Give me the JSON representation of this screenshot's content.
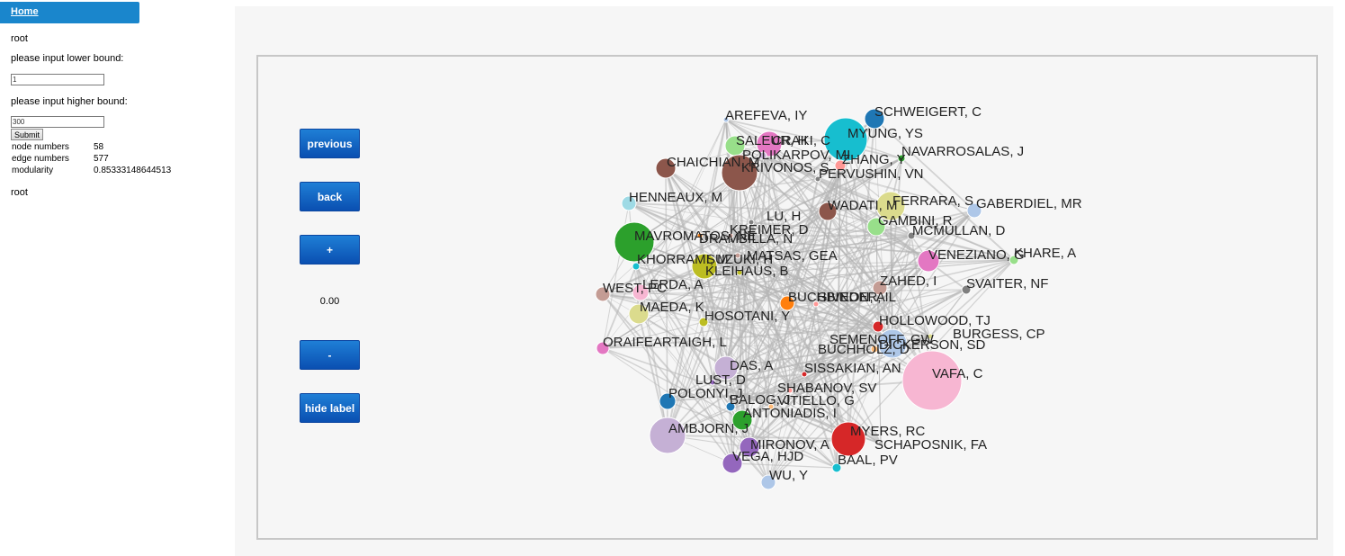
{
  "sidebar": {
    "home_label": "Home",
    "root_label": "root",
    "lower_bound_label": "please input lower bound:",
    "lower_bound_value": "1",
    "higher_bound_label": "please input higher bound:",
    "higher_bound_value": "300",
    "submit_label": "Submit",
    "stats": [
      {
        "label": "node numbers",
        "value": "58"
      },
      {
        "label": "edge numbers",
        "value": "577"
      },
      {
        "label": "modularity",
        "value": "0.85333148644513"
      }
    ],
    "root_footer": "root"
  },
  "controls": {
    "previous_label": "previous",
    "back_label": "back",
    "zoom_in_label": "+",
    "zoom_value": "0.00",
    "zoom_out_label": "-",
    "hide_label": "hide label"
  },
  "graph": {
    "edge_color": "#b5b5b5",
    "nodes": [
      {
        "label": "AREFEVA, IY",
        "color": "#aec7e8"
      },
      {
        "label": "SCHWEIGERT, C",
        "color": "#1f77b4"
      },
      {
        "label": "SALEUR, H",
        "color": "#98df8a"
      },
      {
        "label": "CRAKI, C",
        "color": "#e377c2"
      },
      {
        "label": "MYUNG, YS",
        "color": "#17becf"
      },
      {
        "label": "POLIKARPOV, MI",
        "color": "#c5b0d5"
      },
      {
        "label": "NAVARROSALAS, J",
        "color": "#2ca02c"
      },
      {
        "label": "CHAICHIAN, M",
        "color": "#8c564b"
      },
      {
        "label": "KRIVONOS, S",
        "color": "#8c564b"
      },
      {
        "label": "ZHANG, Y",
        "color": "#ff9896"
      },
      {
        "label": "PERVUSHIN, VN",
        "color": "#7f7f7f"
      },
      {
        "label": "HENNEAUX, M",
        "color": "#9edae5"
      },
      {
        "label": "WADATI, M",
        "color": "#8c564b"
      },
      {
        "label": "FERRARA, S",
        "color": "#dbdb8d"
      },
      {
        "label": "GABERDIEL, MR",
        "color": "#aec7e8"
      },
      {
        "label": "LU, H",
        "color": "#7f7f7f"
      },
      {
        "label": "GAMBINI, R",
        "color": "#98df8a"
      },
      {
        "label": "MAVROMATOS, NE",
        "color": "#2ca02c"
      },
      {
        "label": "KREIMER, D",
        "color": "#c49c94"
      },
      {
        "label": "DRAMBILLA, N",
        "color": "#ff7f0e"
      },
      {
        "label": "MCMULLAN, D",
        "color": "#7f7f7f"
      },
      {
        "label": "VENEZIANO, G",
        "color": "#e377c2"
      },
      {
        "label": "KHARE, A",
        "color": "#98df8a"
      },
      {
        "label": "KHORRAMI, M",
        "color": "#17becf"
      },
      {
        "label": "SUZUKI, H",
        "color": "#bcbd22"
      },
      {
        "label": "MATSAS, GEA",
        "color": "#c49c94"
      },
      {
        "label": "KLEIHAUS, B",
        "color": "#bcbd22"
      },
      {
        "label": "ZAHED, I",
        "color": "#c49c94"
      },
      {
        "label": "SVAITER, NF",
        "color": "#7f7f7f"
      },
      {
        "label": "LERDA, A",
        "color": "#f7b6d2"
      },
      {
        "label": "WEST, PC",
        "color": "#c49c94"
      },
      {
        "label": "BUCHBINDER, IL",
        "color": "#ff7f0e"
      },
      {
        "label": "GIVEON, A",
        "color": "#ff9896"
      },
      {
        "label": "MAEDA, K",
        "color": "#dbdb8d"
      },
      {
        "label": "HOSOTANI, Y",
        "color": "#bcbd22"
      },
      {
        "label": "HOLLOWOOD, TJ",
        "color": "#d62728"
      },
      {
        "label": "ORAIFEARTAIGH, L",
        "color": "#e377c2"
      },
      {
        "label": "SEMENOFF, GW",
        "color": "#aec7e8"
      },
      {
        "label": "BURGESS, CP",
        "color": "#dbdb8d"
      },
      {
        "label": "BUCHHOLZ, D",
        "color": "#ffbb78"
      },
      {
        "label": "DICKERSON, SD",
        "color": "#aec7e8"
      },
      {
        "label": "VAFA, C",
        "color": "#f7b6d2"
      },
      {
        "label": "DAS, A",
        "color": "#c5b0d5"
      },
      {
        "label": "SISSAKIAN, AN",
        "color": "#d62728"
      },
      {
        "label": "LUST, D",
        "color": "#9467bd"
      },
      {
        "label": "SHABANOV, SV",
        "color": "#ff9896"
      },
      {
        "label": "POLONYI, J",
        "color": "#1f77b4"
      },
      {
        "label": "BALOG, J",
        "color": "#1f77b4"
      },
      {
        "label": "VITIELLO, G",
        "color": "#ffbb78"
      },
      {
        "label": "ANTONIADIS, I",
        "color": "#2ca02c"
      },
      {
        "label": "AMBJORN, J",
        "color": "#c5b0d5"
      },
      {
        "label": "MYERS, RC",
        "color": "#d62728"
      },
      {
        "label": "MIRONOV, A",
        "color": "#9467bd"
      },
      {
        "label": "SCHAPOSNIK, FA",
        "color": "#c7c7c7"
      },
      {
        "label": "VEGA, HJD",
        "color": "#9467bd"
      },
      {
        "label": "BAAL, PV",
        "color": "#17becf"
      },
      {
        "label": "WU, Y",
        "color": "#aec7e8"
      }
    ]
  }
}
